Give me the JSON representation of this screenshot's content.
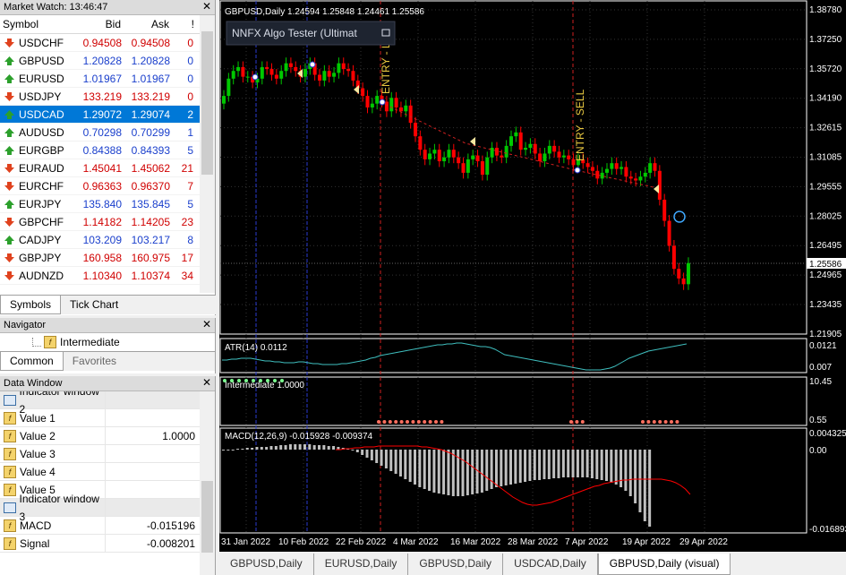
{
  "market_watch": {
    "title": "Market Watch: 13:46:47",
    "col_symbol": "Symbol",
    "col_bid": "Bid",
    "col_ask": "Ask",
    "col_spread": "!",
    "rows": [
      {
        "symbol": "USDCHF",
        "bid": "0.94508",
        "ask": "0.94508",
        "spread": "0",
        "dir": "down"
      },
      {
        "symbol": "GBPUSD",
        "bid": "1.20828",
        "ask": "1.20828",
        "spread": "0",
        "dir": "up"
      },
      {
        "symbol": "EURUSD",
        "bid": "1.01967",
        "ask": "1.01967",
        "spread": "0",
        "dir": "up"
      },
      {
        "symbol": "USDJPY",
        "bid": "133.219",
        "ask": "133.219",
        "spread": "0",
        "dir": "down"
      },
      {
        "symbol": "USDCAD",
        "bid": "1.29072",
        "ask": "1.29074",
        "spread": "2",
        "dir": "up"
      },
      {
        "symbol": "AUDUSD",
        "bid": "0.70298",
        "ask": "0.70299",
        "spread": "1",
        "dir": "up"
      },
      {
        "symbol": "EURGBP",
        "bid": "0.84388",
        "ask": "0.84393",
        "spread": "5",
        "dir": "up"
      },
      {
        "symbol": "EURAUD",
        "bid": "1.45041",
        "ask": "1.45062",
        "spread": "21",
        "dir": "down"
      },
      {
        "symbol": "EURCHF",
        "bid": "0.96363",
        "ask": "0.96370",
        "spread": "7",
        "dir": "down"
      },
      {
        "symbol": "EURJPY",
        "bid": "135.840",
        "ask": "135.845",
        "spread": "5",
        "dir": "up"
      },
      {
        "symbol": "GBPCHF",
        "bid": "1.14182",
        "ask": "1.14205",
        "spread": "23",
        "dir": "down"
      },
      {
        "symbol": "CADJPY",
        "bid": "103.209",
        "ask": "103.217",
        "spread": "8",
        "dir": "up"
      },
      {
        "symbol": "GBPJPY",
        "bid": "160.958",
        "ask": "160.975",
        "spread": "17",
        "dir": "down"
      },
      {
        "symbol": "AUDNZD",
        "bid": "1.10340",
        "ask": "1.10374",
        "spread": "34",
        "dir": "down"
      }
    ],
    "tabs": [
      "Symbols",
      "Tick Chart"
    ]
  },
  "navigator": {
    "title": "Navigator",
    "item": "Intermediate",
    "tabs": [
      "Common",
      "Favorites"
    ]
  },
  "data_window": {
    "title": "Data Window",
    "rows": [
      {
        "name": "Indicator window 2",
        "value": "",
        "group": true
      },
      {
        "name": "Value 1",
        "value": ""
      },
      {
        "name": "Value 2",
        "value": "1.0000"
      },
      {
        "name": "Value 3",
        "value": ""
      },
      {
        "name": "Value 4",
        "value": ""
      },
      {
        "name": "Value 5",
        "value": ""
      },
      {
        "name": "Indicator window 3",
        "value": "",
        "group": true
      },
      {
        "name": "MACD",
        "value": "-0.015196"
      },
      {
        "name": "Signal",
        "value": "-0.008201"
      }
    ]
  },
  "chart": {
    "header": "GBPUSD,Daily  1.24594 1.25848 1.24461 1.25586",
    "ea_label": "NNFX Algo Tester (Ultimat",
    "entry1": "ENTRY - L",
    "entry2": "ENTRY - SELL",
    "price_labels": [
      "1.38780",
      "1.37250",
      "1.35720",
      "1.34190",
      "1.32615",
      "1.31085",
      "1.29555",
      "1.28025",
      "1.26495",
      "1.24965",
      "1.23435",
      "1.21905"
    ],
    "current_price": "1.25586",
    "atr_label": "ATR(14) 0.0112",
    "atr_scale": [
      "0.0121",
      "0.007"
    ],
    "inter_label": "Intermediate 1.0000",
    "inter_scale": [
      "10.45",
      "0.55"
    ],
    "macd_label": "MACD(12,26,9) -0.015928 -0.009374",
    "macd_scale": [
      "0.004325",
      "0.00",
      "-0.016893"
    ],
    "dates": [
      "31 Jan 2022",
      "10 Feb 2022",
      "22 Feb 2022",
      "4 Mar 2022",
      "16 Mar 2022",
      "28 Mar 2022",
      "7 Apr 2022",
      "19 Apr 2022",
      "29 Apr 2022"
    ],
    "colors": {
      "bull": "#00c800",
      "bear": "#ff0000",
      "atr": "#3fbfbf",
      "signal": "#ff0000",
      "histo": "#c0c0c0"
    }
  },
  "bottom_tabs": [
    "GBPUSD,Daily",
    "EURUSD,Daily",
    "GBPUSD,Daily",
    "USDCAD,Daily",
    "GBPUSD,Daily (visual)"
  ]
}
